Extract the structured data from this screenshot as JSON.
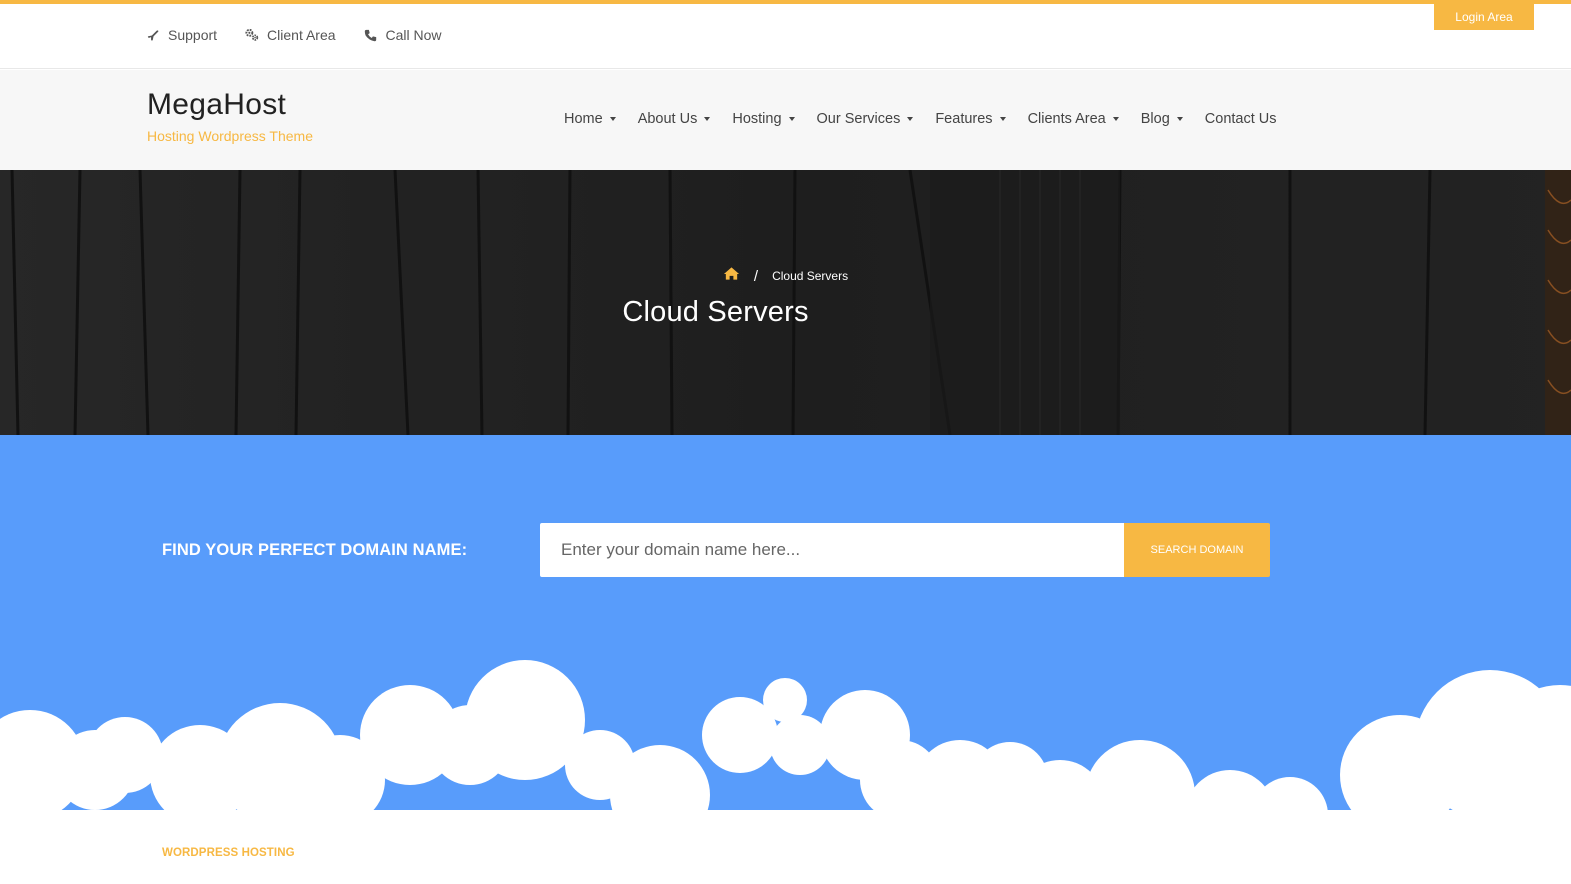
{
  "colors": {
    "accent": "#f7b843",
    "domain_bg": "#589cfb",
    "hero_bg": "#262626"
  },
  "topbar": {
    "links": [
      {
        "label": "Support",
        "icon": "plane-icon"
      },
      {
        "label": "Client Area",
        "icon": "cogs-icon"
      },
      {
        "label": "Call Now",
        "icon": "phone-icon"
      }
    ],
    "login_label": "Login Area"
  },
  "header": {
    "logo": "MegaHost",
    "tagline": "Hosting Wordpress Theme",
    "nav": [
      {
        "label": "Home",
        "has_dropdown": true
      },
      {
        "label": "About Us",
        "has_dropdown": true
      },
      {
        "label": "Hosting",
        "has_dropdown": true
      },
      {
        "label": "Our Services",
        "has_dropdown": true
      },
      {
        "label": "Features",
        "has_dropdown": true
      },
      {
        "label": "Clients Area",
        "has_dropdown": true
      },
      {
        "label": "Blog",
        "has_dropdown": true
      },
      {
        "label": "Contact Us",
        "has_dropdown": false
      }
    ]
  },
  "hero": {
    "breadcrumb_home_icon": "home-icon",
    "breadcrumb_separator": "/",
    "breadcrumb_current": "Cloud Servers",
    "title": "Cloud Servers"
  },
  "domain_search": {
    "label": "FIND YOUR PERFECT DOMAIN NAME:",
    "placeholder": "Enter your domain name here...",
    "value": "",
    "button_label": "SEARCH DOMAIN"
  },
  "section": {
    "tag": "WORDPRESS HOSTING"
  }
}
